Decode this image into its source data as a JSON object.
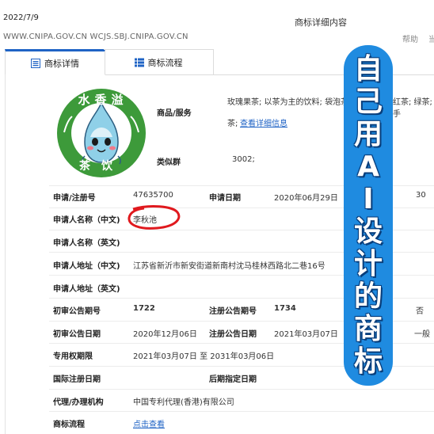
{
  "header": {
    "date": "2022/7/9",
    "title": "商标详细内容",
    "url": "WWW.CNIPA.GOV.CN WCJS.SBJ.CNIPA.GOV.CN",
    "help": "帮助",
    "help2": "当"
  },
  "tabs": [
    {
      "label": "商标详情"
    },
    {
      "label": "商标流程"
    }
  ],
  "logo": {
    "top_text": "水香溢",
    "bottom_text": "茶饮"
  },
  "goods": {
    "label": "商品/服务",
    "line1": "玫瑰果茶; 以茶为主的饮料; 袋泡茶",
    "line1_tail": "红茶; 绿茶; 手",
    "line2": "茶;",
    "more_link": "查看详细信息"
  },
  "similar_group": {
    "label": "类似群",
    "value": "3002;"
  },
  "rows": {
    "reg_no_label": "申请/注册号",
    "reg_no_value": "47635700",
    "apply_date_label": "申请日期",
    "apply_date_value": "2020年06月29日",
    "class_value": "30",
    "applicant_cn_label": "申请人名称（中文)",
    "applicant_cn_value": "李秋池",
    "applicant_en_label": "申请人名称（英文)",
    "address_cn_label": "申请人地址（中文)",
    "address_cn_value": "江苏省新沂市新安街道新南村沈马桂林西路北二巷16号",
    "address_en_label": "申请人地址（英文)",
    "prelim_no_label": "初审公告期号",
    "prelim_no_value": "1722",
    "reg_pub_no_label": "注册公告期号",
    "reg_pub_no_value": "1734",
    "reg_pub_no_extra": "否",
    "prelim_date_label": "初审公告日期",
    "prelim_date_value": "2020年12月06日",
    "reg_pub_date_label": "注册公告日期",
    "reg_pub_date_value": "2021年03月07日",
    "reg_pub_date_extra": "一般",
    "exclusive_label": "专用权期限",
    "exclusive_value": "2021年03月07日 至 2031年03月06日",
    "intl_date_label": "国际注册日期",
    "later_date_label": "后期指定日期",
    "agent_label": "代理/办理机构",
    "agent_value": "中国专利代理(香港)有限公司",
    "flow_label": "商标流程",
    "flow_link": "点击查看"
  },
  "banner": {
    "chars": [
      "自",
      "己",
      "用",
      "A",
      "I",
      "设",
      "计",
      "的",
      "商",
      "标"
    ]
  },
  "colors": {
    "tab_accent": "#1f63c5",
    "link": "#1f63c5",
    "banner": "#1f8be0",
    "circle_mark": "#e0191e",
    "logo_green": "#3d9a3a"
  }
}
